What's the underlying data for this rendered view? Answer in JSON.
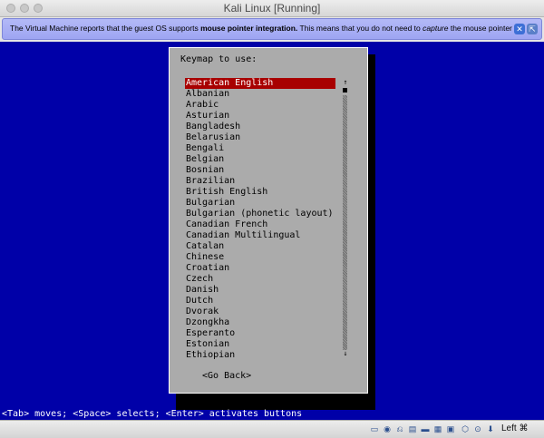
{
  "window": {
    "title": "Kali Linux [Running]"
  },
  "banner": {
    "text_pre": "The Virtual Machine reports that the guest OS supports ",
    "text_bold": "mouse pointer integration.",
    "text_mid": " This means that you do not need to ",
    "text_italic": "capture",
    "text_post": " the mouse pointer to",
    "icons": [
      "info-close-icon",
      "mouse-integration-icon"
    ]
  },
  "dialog": {
    "prompt": "Keymap to use:",
    "items": [
      "American English",
      "Albanian",
      "Arabic",
      "Asturian",
      "Bangladesh",
      "Belarusian",
      "Bengali",
      "Belgian",
      "Bosnian",
      "Brazilian",
      "British English",
      "Bulgarian",
      "Bulgarian (phonetic layout)",
      "Canadian French",
      "Canadian Multilingual",
      "Catalan",
      "Chinese",
      "Croatian",
      "Czech",
      "Danish",
      "Dutch",
      "Dvorak",
      "Dzongkha",
      "Esperanto",
      "Estonian",
      "Ethiopian"
    ],
    "selected_index": 0,
    "scroll_up": "↑",
    "scroll_down": "↓",
    "go_back": "<Go Back>"
  },
  "helpline": "<Tab> moves; <Space> selects; <Enter> activates buttons",
  "statusbar": {
    "icons": [
      "hard-disk-icon",
      "optical-drive-icon",
      "usb-icon",
      "shared-folder-icon",
      "display-icon",
      "video-capture-icon",
      "network-icon",
      "mouse-integration-icon",
      "keyboard-capture-icon",
      "cpu-icon"
    ],
    "host_key": "Left ⌘"
  },
  "colors": {
    "screen_bg": "#0000a8",
    "dialog_bg": "#ababab",
    "selection_bg": "#a80000",
    "banner_bg": "#aab0f5"
  }
}
